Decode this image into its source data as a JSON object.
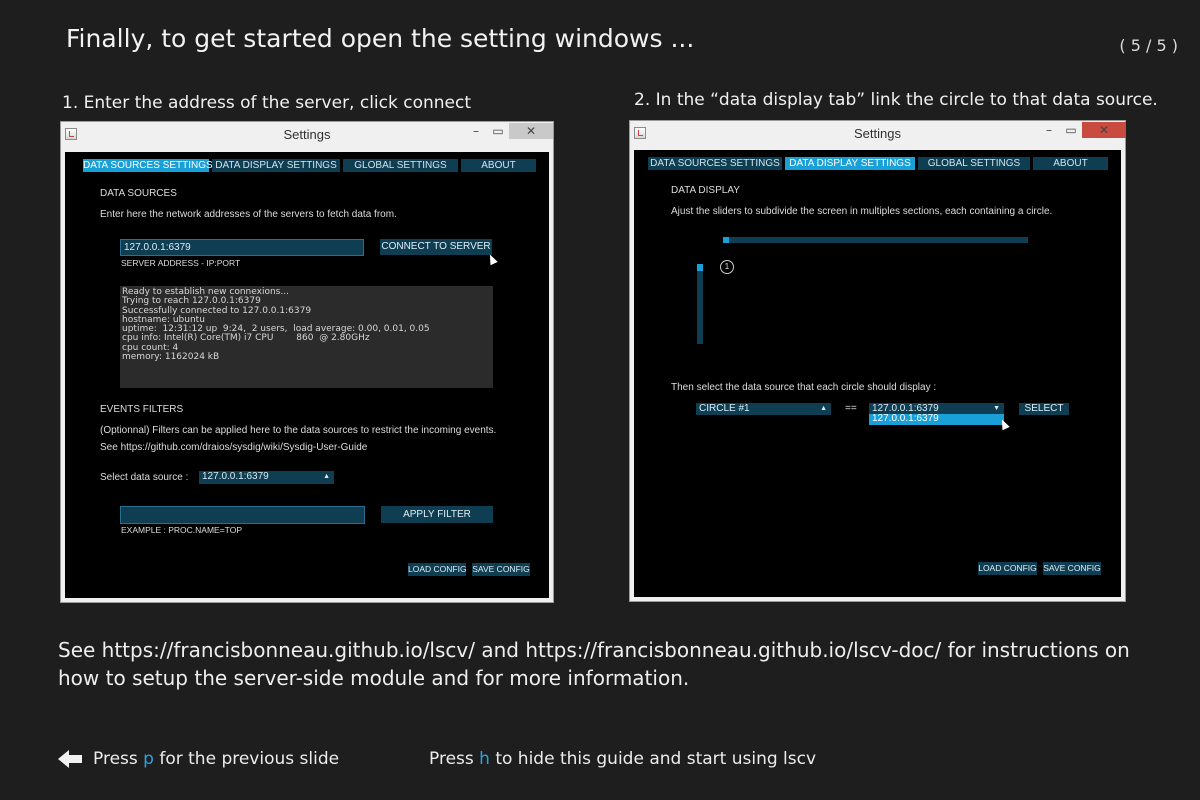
{
  "page": {
    "title": "Finally, to get started open the setting windows ...",
    "counter": "( 5 / 5 )",
    "step1": "1. Enter the address of the server, click connect",
    "step2": "2. In the “data display tab” link the circle to that data source.",
    "footer": "See https://francisbonneau.github.io/lscv/ and https://francisbonneau.github.io/lscv-doc/ for instructions on how to setup the server-side module and for more information.",
    "nav_prev_before": "Press ",
    "nav_prev_key": "p",
    "nav_prev_after": " for the previous slide",
    "nav_hide_before": "Press ",
    "nav_hide_key": "h",
    "nav_hide_after": " to hide this guide and start using lscv"
  },
  "window": {
    "title": "Settings",
    "minimize": "–",
    "maximize": "▭",
    "close": "✕"
  },
  "tabs": [
    "DATA SOURCES SETTINGS",
    "DATA DISPLAY SETTINGS",
    "GLOBAL SETTINGS",
    "ABOUT"
  ],
  "sources": {
    "heading": "DATA SOURCES",
    "description": "Enter here the network addresses of the servers to fetch data from.",
    "server_value": "127.0.0.1:6379",
    "server_hint": "SERVER ADDRESS - IP:PORT",
    "connect_label": "CONNECT TO SERVER",
    "log": [
      "Ready to establish new connexions...",
      "Trying to reach 127.0.0.1:6379",
      "Successfully connected to 127.0.0.1:6379",
      "hostname: ubuntu",
      "uptime:  12:31:12 up  9:24,  2 users,  load average: 0.00, 0.01, 0.05",
      "cpu info: Intel(R) Core(TM) i7 CPU        860  @ 2.80GHz",
      "cpu count: 4",
      "memory: 1162024 kB"
    ],
    "filters_heading": "EVENTS FILTERS",
    "filters_desc": "(Optionnal) Filters can be applied here to the data sources to restrict the incoming events.",
    "filters_link": "See https://github.com/draios/sysdig/wiki/Sysdig-User-Guide",
    "select_label": "Select data source :",
    "select_value": "127.0.0.1:6379",
    "filter_value": "",
    "filter_example": "EXAMPLE : PROC.NAME=TOP",
    "apply_label": "APPLY FILTER",
    "load_label": "LOAD CONFIG",
    "save_label": "SAVE CONFIG"
  },
  "display": {
    "heading": "DATA DISPLAY",
    "description": "Ajust the sliders to subdivide  the screen in multiples sections, each containing a circle.",
    "circle_number": "1",
    "select_prompt": "Then select the data source that each circle should display :",
    "circle_select": "CIRCLE #1",
    "equals": "==",
    "source_select": "127.0.0.1:6379",
    "source_option": "127.0.0.1:6379",
    "select_button": "SELECT",
    "load_label": "LOAD CONFIG",
    "save_label": "SAVE CONFIG"
  },
  "colors": {
    "background": "#1e1e1e",
    "accent": "#29a3e0",
    "tab_active": "#1aa0d8",
    "control_bg": "#0f3d52"
  },
  "icons": {
    "window_icon": "java-icon",
    "prev_icon": "arrow-left-icon",
    "cursor": "mouse-pointer-icon"
  }
}
